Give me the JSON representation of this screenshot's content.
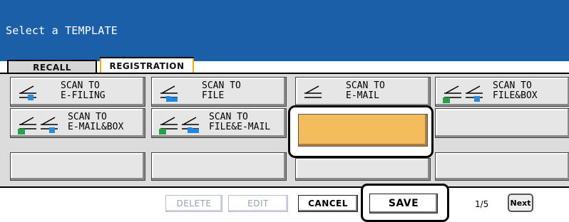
{
  "header": {
    "title": "Select a TEMPLATE"
  },
  "tabs": {
    "recall": "RECALL",
    "registration": "REGISTRATION"
  },
  "templates": {
    "scan_efiling": "SCAN TO\nE-FILING",
    "scan_file": "SCAN TO\nFILE",
    "scan_email": "SCAN TO\nE-MAIL",
    "scan_filebox": "SCAN TO\nFILE&BOX",
    "scan_emailbox": "SCAN TO\nE-MAIL&BOX",
    "scan_fileemail": "SCAN TO\nFILE&E-MAIL"
  },
  "footer": {
    "delete_label": "DELETE",
    "edit_label": "EDIT",
    "cancel_label": "CANCEL",
    "save_label": "SAVE",
    "page_indicator": "1/5",
    "next_label": "Next"
  },
  "colors": {
    "header": "#1a5fa8",
    "selected": "#f3bd5e",
    "tab_accent": "#f0b000"
  }
}
